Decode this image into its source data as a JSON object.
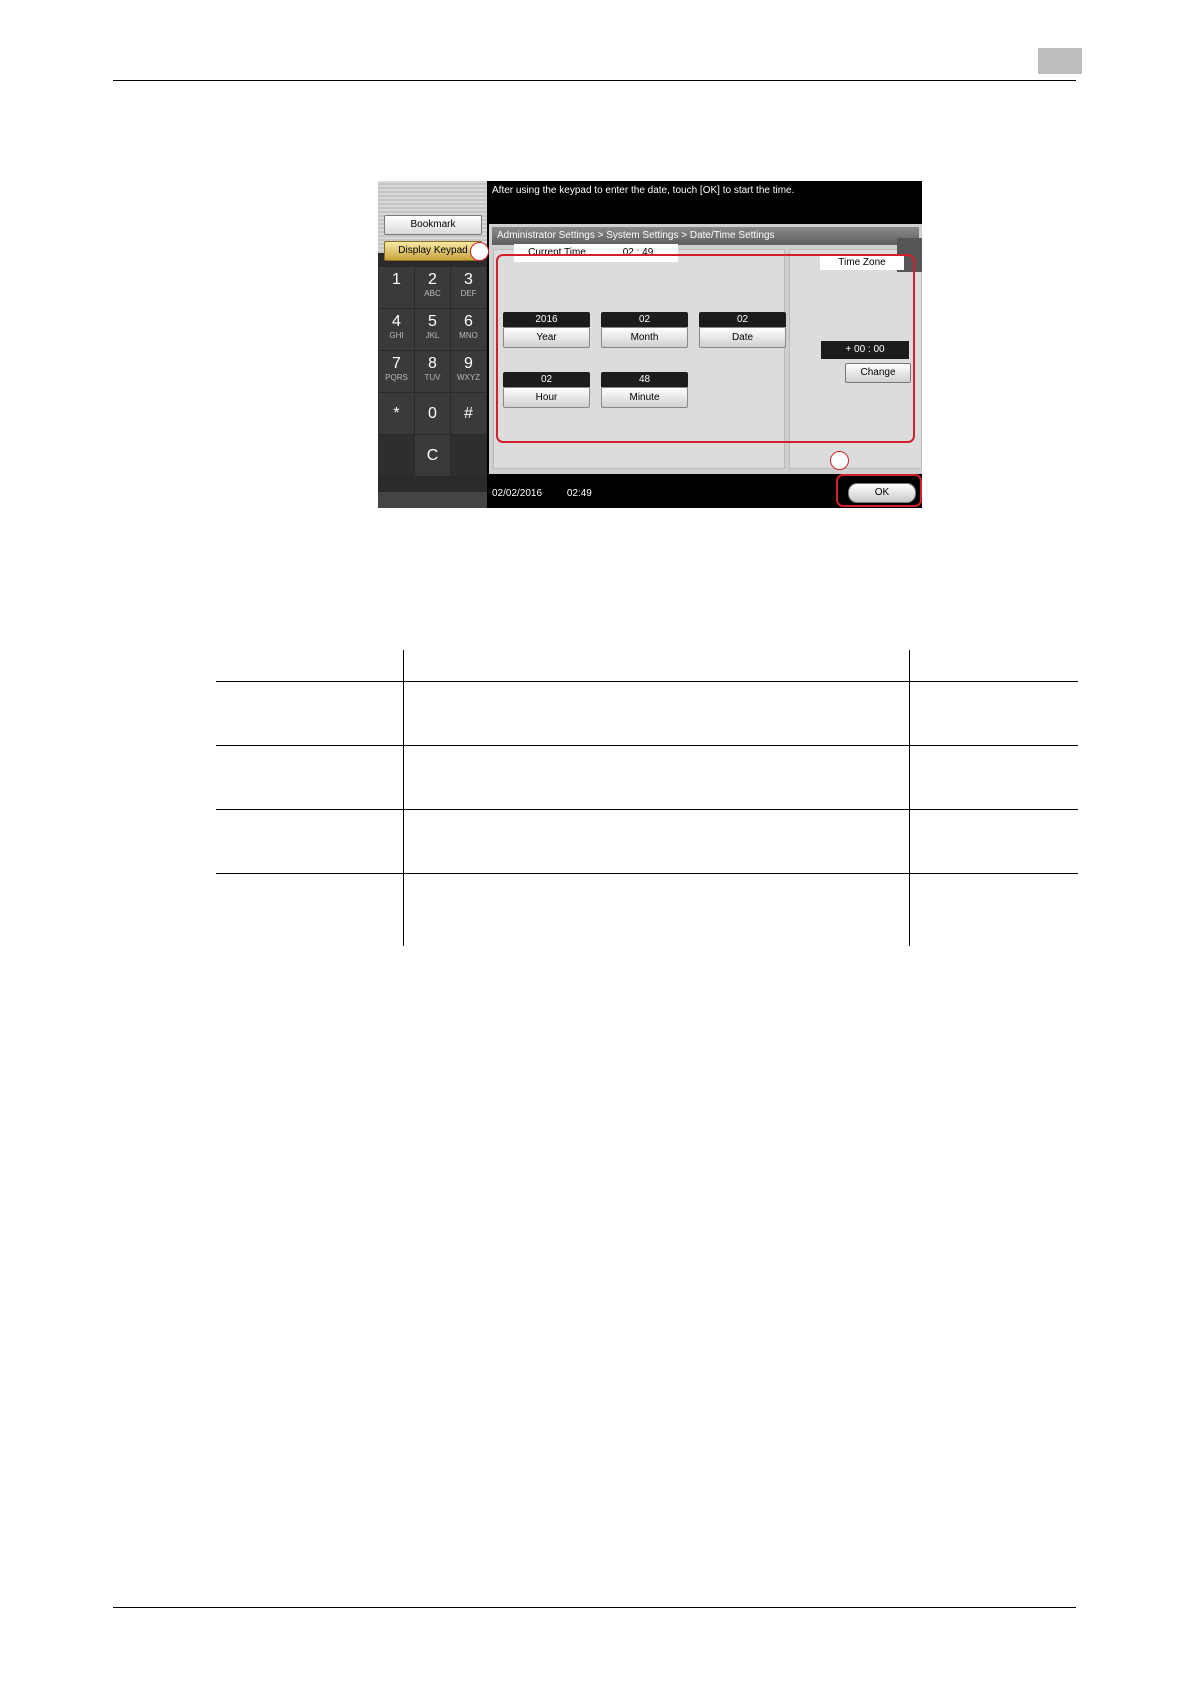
{
  "screen": {
    "message": "After using the keypad to enter the date, touch [OK] to start the time.",
    "breadcrumb": "Administrator Settings > System Settings > Date/Time Settings",
    "bookmark_label": "Bookmark",
    "display_keypad_label": "Display Keypad",
    "keypad": [
      {
        "digit": "1",
        "letters": ""
      },
      {
        "digit": "2",
        "letters": "ABC"
      },
      {
        "digit": "3",
        "letters": "DEF"
      },
      {
        "digit": "4",
        "letters": "GHI"
      },
      {
        "digit": "5",
        "letters": "JKL"
      },
      {
        "digit": "6",
        "letters": "MNO"
      },
      {
        "digit": "7",
        "letters": "PQRS"
      },
      {
        "digit": "8",
        "letters": "TUV"
      },
      {
        "digit": "9",
        "letters": "WXYZ"
      },
      {
        "digit": "*",
        "letters": ""
      },
      {
        "digit": "0",
        "letters": ""
      },
      {
        "digit": "#",
        "letters": ""
      },
      {
        "digit": "C",
        "letters": ""
      }
    ],
    "current_time_label": "Current Time",
    "current_time_value": "02 : 49",
    "fields": {
      "year": {
        "value": "2016",
        "label": "Year"
      },
      "month": {
        "value": "02",
        "label": "Month"
      },
      "date": {
        "value": "02",
        "label": "Date"
      },
      "hour": {
        "value": "02",
        "label": "Hour"
      },
      "minute": {
        "value": "48",
        "label": "Minute"
      }
    },
    "time_zone_label": "Time Zone",
    "time_zone_value": "+ 00 : 00",
    "change_label": "Change",
    "status_date": "02/02/2016",
    "status_time": "02:49",
    "ok_label": "OK"
  }
}
